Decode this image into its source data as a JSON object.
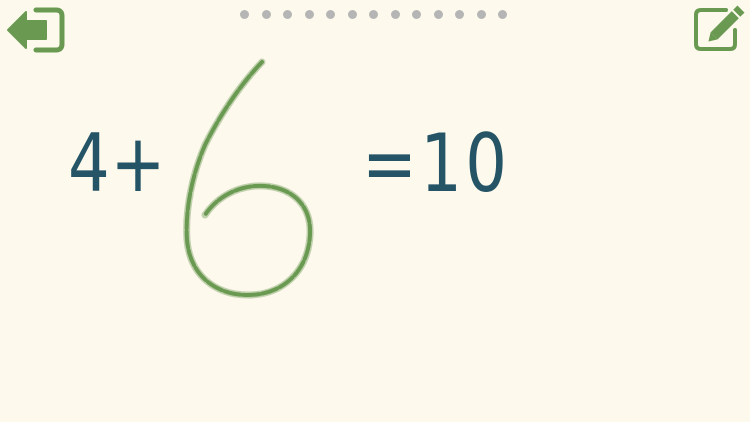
{
  "equation": {
    "left": "4+",
    "right": "=10"
  },
  "answer": {
    "handwritten_digit": "6"
  },
  "progress": {
    "total_dots": 13
  },
  "toolbar": {
    "back_icon": "back-arrow-icon",
    "edit_icon": "pencil-edit-icon"
  },
  "colors": {
    "background": "#fdf9ec",
    "accent_green": "#6a9a52",
    "equation_text": "#245466",
    "dot_gray": "#b5b5b5"
  }
}
